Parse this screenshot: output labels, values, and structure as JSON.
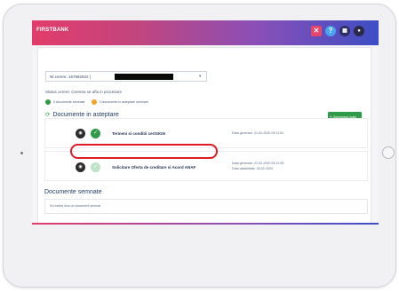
{
  "header": {
    "brand": "FIRSTBANK",
    "icons": [
      "close-icon",
      "help-icon",
      "grid-icon",
      "user-icon"
    ],
    "gradient_colors": [
      "#e23c6a",
      "#8a4fb7",
      "#3d4ec4"
    ]
  },
  "request_select": {
    "value": "Nr.cerere: 167582522 |"
  },
  "status": {
    "text": "Status cerere: Cererea se afla in procesare"
  },
  "counters": {
    "signed": "0 documente semnate",
    "pending": "2 documente in asteptare semnare"
  },
  "pending_section": {
    "title": "Documente in asteptare",
    "sign_all_label": "Semneaza toate"
  },
  "documents": [
    {
      "title": "Termeni si conditii certSIGN",
      "date_line1": "Data generare: 21-02-2020 09:11:51",
      "date_line2": ""
    },
    {
      "title": "Solicitare Oferta de creditare si Acord ANAF",
      "date_line1": "Data generare: 21-02-2020 09:12:05",
      "date_line2": "Data valabilitate: 26-02-2020"
    }
  ],
  "signed_section": {
    "title": "Documente semnate",
    "empty_text": "Nu exista inca un document semnat"
  },
  "colors": {
    "accent_green": "#2f9a47",
    "pending_orange": "#f3a227",
    "highlight_red": "#e01b24",
    "title_blue": "#1f3a63"
  }
}
